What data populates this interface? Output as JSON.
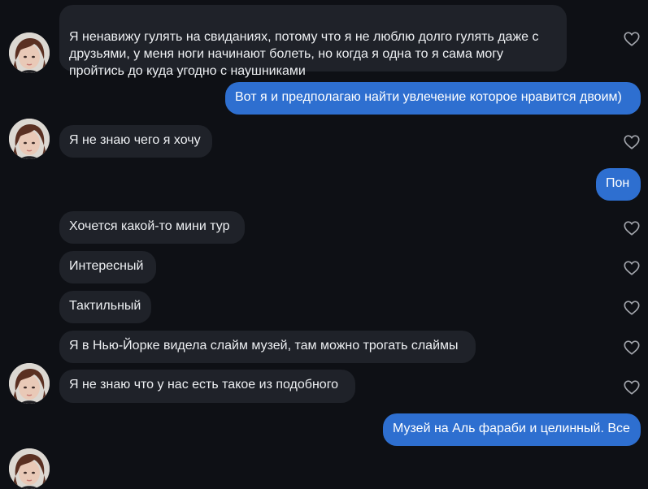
{
  "messages": [
    {
      "text": "Я ненавижу гулять на свиданиях, потому что я не люблю долго гулять даже с\nдрузьями, у меня ноги начинают болеть, но когда я одна то я сама могу\nпройтись до куда угодно с наушниками"
    },
    {
      "text": "Вот я и предполагаю найти увлечение которое нравится двоим)"
    },
    {
      "text": "Я не знаю чего я хочу"
    },
    {
      "text": "Пон"
    },
    {
      "text": "Хочется какой-то мини тур"
    },
    {
      "text": "Интересный"
    },
    {
      "text": "Тактильный"
    },
    {
      "text": "Я в Нью-Йорке видела слайм музей, там можно трогать слаймы"
    },
    {
      "text": "Я не знаю что у нас есть такое из подобного"
    },
    {
      "text": "Музей на Аль фараби и целинный. Все"
    }
  ],
  "colors": {
    "background": "#0e1015",
    "incoming_bubble": "#1f2229",
    "outgoing_bubble": "#2e6fd0",
    "text": "#eef0f3",
    "like_icon": "#a3a6ad"
  }
}
